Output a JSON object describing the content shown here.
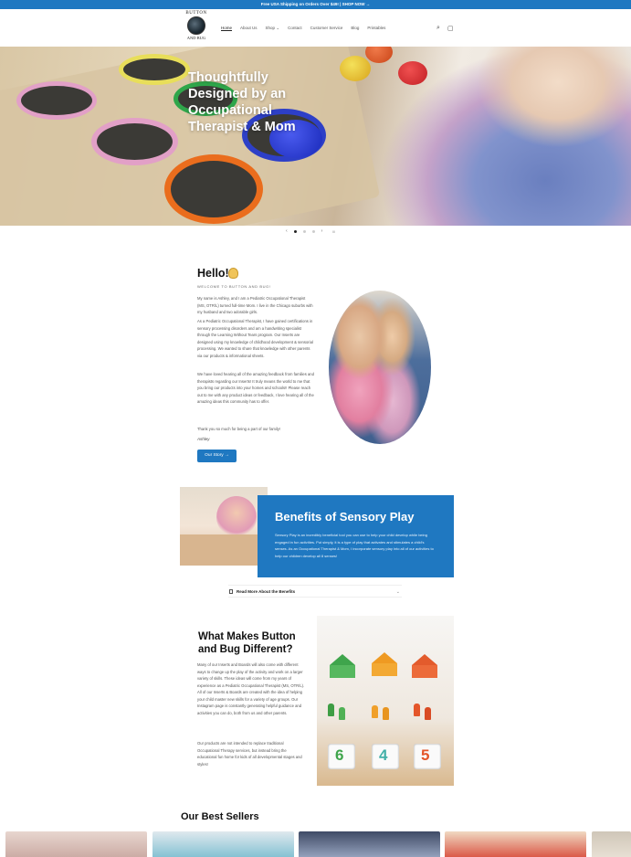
{
  "announcement": {
    "text": "Free USA Shipping on Orders Over $49! | SHOP NOW →"
  },
  "logo": {
    "top": "BUTTON",
    "bottom": "AND BUG"
  },
  "nav": {
    "items": [
      "Home",
      "About Us",
      "Shop",
      "Contact",
      "Customer Service",
      "Blog",
      "Printables"
    ],
    "shop_chevron": "⌄"
  },
  "header_icons": {
    "search": "⌕",
    "cart": "▢"
  },
  "hero": {
    "title": "Thoughtfully Designed by an Occupational Therapist & Mom",
    "prev": "‹",
    "next": "›",
    "pause": "II"
  },
  "hello": {
    "title": "Hello!",
    "subtitle": "WELCOME TO BUTTON AND BUG!",
    "p1": "My name is Ashley, and I am a Pediatric Occupational Therapist (MS, OTR/L) turned full-time Mom. I live in the Chicago suburbs with my husband and two adorable girls.",
    "p2": "As a Pediatric Occupational Therapist, I have gained certifications in sensory processing disorders and am a handwriting specialist through the Learning Without Tears program. Our Inserts are designed using my knowledge of childhood development & sensorial processing. We wanted to share that knowledge with other parents via our products & informational sheets.",
    "p3": "We have loved hearing all of the amazing feedback from families and therapists regarding our Inserts! It truly means the world to me that you bring our products into your homes and schools!! Please reach out to me with any product ideas or feedback, I love hearing all of the amazing ideas this community has to offer.",
    "p4": "Thank you so much for being a part of our family!",
    "signature": "Ashley",
    "button": "Our Story →"
  },
  "sensory": {
    "title": "Benefits of Sensory Play",
    "text": "Sensory Play is an incredibly beneficial tool you can use to help your child develop while being engaged in fun activities. Put simply, it is a type of play that activates and stimulates a child's senses. As an Occupational Therapist & Mom, I incorporate sensory play into all of our activities to help our children develop all 8 senses!",
    "accordion": "Read More About the Benefits",
    "accordion_chevron": "⌄"
  },
  "difference": {
    "title": "What Makes Button and Bug Different?",
    "p1": "Many of our Inserts and Boards will also come with different ways to change up the play of the activity and work on a larger variety of skills. These ideas will come from my years of experience as a Pediatric Occupational Therapist (MS, OTR/L). All of our Inserts & Boards are created with the idea of helping your child master new skills for a variety of age groups. Our Instagram page is constantly generating helpful guidance and activities you can do, both from us and other parents.",
    "p2": "Our products are not intended to replace traditional Occupational Therapy services, but instead bring the educational fun home for kids of all developmental stages and styles!",
    "tiles": [
      "6",
      "4",
      "5"
    ]
  },
  "best_sellers": {
    "title": "Our Best Sellers"
  },
  "colors": {
    "accent": "#1f78c1"
  }
}
